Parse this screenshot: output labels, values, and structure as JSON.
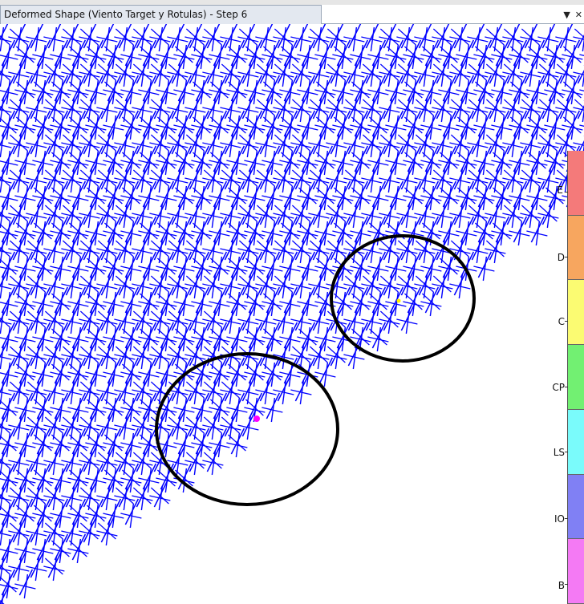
{
  "window": {
    "title": "Deformed Shape (Viento Target y Rotulas) - Step 6",
    "dropdown_icon": "chevron-down-icon",
    "close_icon": "close-icon"
  },
  "legend": {
    "segments": [
      {
        "color": "#f47a7a"
      },
      {
        "color": "#f7a65f"
      },
      {
        "color": "#fbfb72"
      },
      {
        "color": "#72f072"
      },
      {
        "color": "#7afbfb"
      },
      {
        "color": "#8080f4"
      },
      {
        "color": "#f47af4"
      }
    ],
    "labels": [
      "E",
      "D",
      "C",
      "CP",
      "LS",
      "IO",
      "B"
    ]
  },
  "colors": {
    "mesh": "#0000ff",
    "highlight_circle": "#000000",
    "hinge_magenta": "#ff00ff",
    "hinge_yellow": "#ffee00"
  }
}
